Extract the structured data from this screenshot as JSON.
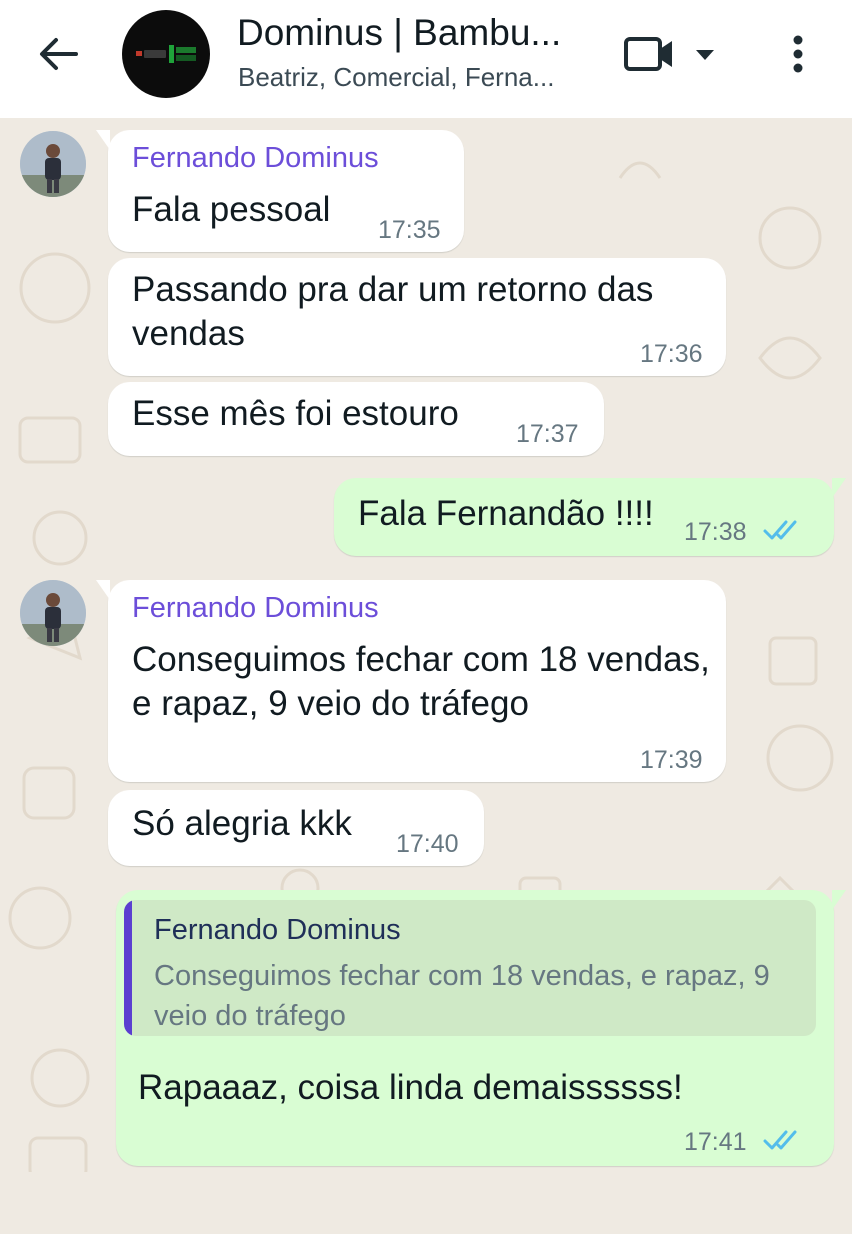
{
  "header": {
    "title": "Dominus | Bambu...",
    "subtitle": "Beatriz, Comercial, Ferna...",
    "avatar_logo_text": "Dominus Bambu"
  },
  "icons": {
    "back": "arrow-left-icon",
    "video": "video-camera-icon",
    "dropdown": "chevron-down-icon",
    "menu": "more-vertical-icon",
    "read": "double-check-icon"
  },
  "colors": {
    "incoming_bubble": "#ffffff",
    "outgoing_bubble": "#d9fdd3",
    "sender_name": "#6c4ed9",
    "read_ticks": "#53bdeb",
    "chat_background": "#efeae2"
  },
  "messages": [
    {
      "direction": "incoming",
      "sender": "Fernando Dominus",
      "text": "Fala pessoal",
      "time": "17:35"
    },
    {
      "direction": "incoming",
      "text": "Passando pra dar um retorno das vendas",
      "time": "17:36"
    },
    {
      "direction": "incoming",
      "text": "Esse mês foi estouro",
      "time": "17:37"
    },
    {
      "direction": "outgoing",
      "text": "Fala Fernandão !!!!",
      "time": "17:38",
      "status": "read"
    },
    {
      "direction": "incoming",
      "sender": "Fernando Dominus",
      "text": "Conseguimos fechar com 18 vendas, e rapaz, 9 veio do tráfego",
      "time": "17:39"
    },
    {
      "direction": "incoming",
      "text": "Só alegria kkk",
      "time": "17:40"
    },
    {
      "direction": "outgoing",
      "quoted": {
        "sender": "Fernando Dominus",
        "text": "Conseguimos fechar com 18 vendas, e rapaz, 9 veio do tráfego"
      },
      "text": "Rapaaaz, coisa linda demaissssss!",
      "time": "17:41",
      "status": "read"
    }
  ]
}
